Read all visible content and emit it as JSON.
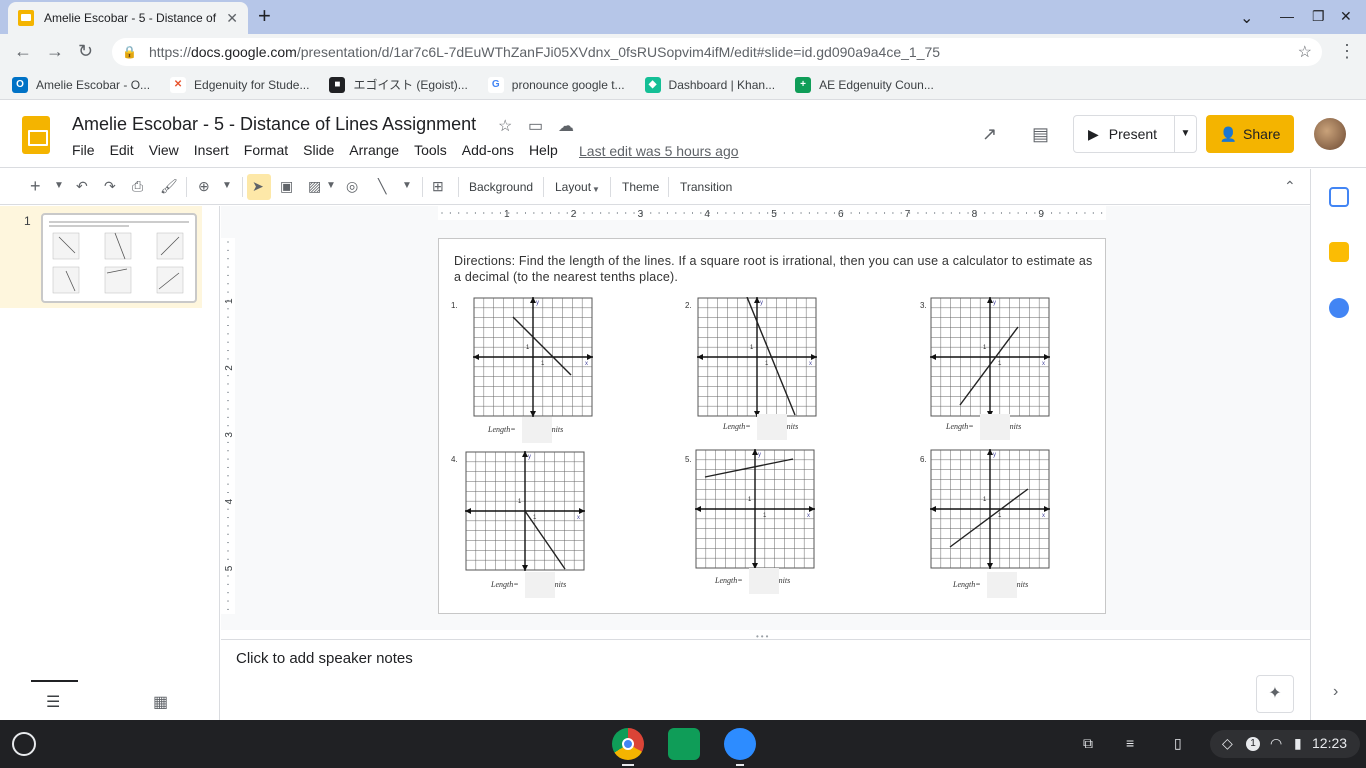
{
  "browser": {
    "tab_title": "Amelie Escobar - 5 - Distance of",
    "url_prefix": "https://",
    "url_host": "docs.google.com",
    "url_path": "/presentation/d/1ar7c6L-7dEuWThZanFJi05XVdnx_0fsRUSopvim4ifM/edit#slide=id.gd090a9a4ce_1_75",
    "bookmarks": [
      {
        "label": "Amelie Escobar - O...",
        "icon": "outlook-icon",
        "color": "#0072c6",
        "glyph": "O"
      },
      {
        "label": "Edgenuity for Stude...",
        "icon": "edgenuity-icon",
        "color": "#e8542e",
        "glyph": "✕"
      },
      {
        "label": "エゴイスト (Egoist)...",
        "icon": "bookmark-icon",
        "color": "#202124",
        "glyph": "■"
      },
      {
        "label": "pronounce google t...",
        "icon": "google-icon",
        "color": "#4285f4",
        "glyph": "G"
      },
      {
        "label": "Dashboard | Khan...",
        "icon": "khan-icon",
        "color": "#14bf96",
        "glyph": "◆"
      },
      {
        "label": "AE Edgenuity Coun...",
        "icon": "sheets-icon",
        "color": "#0f9d58",
        "glyph": "+"
      }
    ]
  },
  "app": {
    "doc_title": "Amelie Escobar - 5 - Distance of Lines Assignment",
    "menu": [
      "File",
      "Edit",
      "View",
      "Insert",
      "Format",
      "Slide",
      "Arrange",
      "Tools",
      "Add-ons",
      "Help"
    ],
    "last_edit": "Last edit was 5 hours ago",
    "present_label": "Present",
    "share_label": "Share"
  },
  "toolbar": {
    "background": "Background",
    "layout": "Layout",
    "theme": "Theme",
    "transition": "Transition"
  },
  "filmstrip": {
    "slide_number": "1"
  },
  "ruler": {
    "h_ticks": [
      "1",
      "2",
      "3",
      "4",
      "5",
      "6",
      "7",
      "8",
      "9"
    ],
    "v_ticks": [
      "1",
      "2",
      "3",
      "4",
      "5"
    ]
  },
  "slide": {
    "directions": "Directions:  Find the length of the lines.  If a square root is irrational, then you can use a calculator to estimate as a decimal (to the nearest tenths place).",
    "problems": [
      {
        "num": "1.",
        "length_label": "Length=",
        "units": "units"
      },
      {
        "num": "2.",
        "length_label": "Length=",
        "units": "units"
      },
      {
        "num": "3.",
        "length_label": "Length=",
        "units": "units"
      },
      {
        "num": "4.",
        "length_label": "Length=",
        "units": "units"
      },
      {
        "num": "5.",
        "length_label": "Length=",
        "units": "units"
      },
      {
        "num": "6.",
        "length_label": "Length=",
        "units": "units"
      }
    ]
  },
  "notes": {
    "placeholder": "Click to add speaker notes"
  },
  "system": {
    "time": "12:23",
    "notification_count": "1"
  }
}
